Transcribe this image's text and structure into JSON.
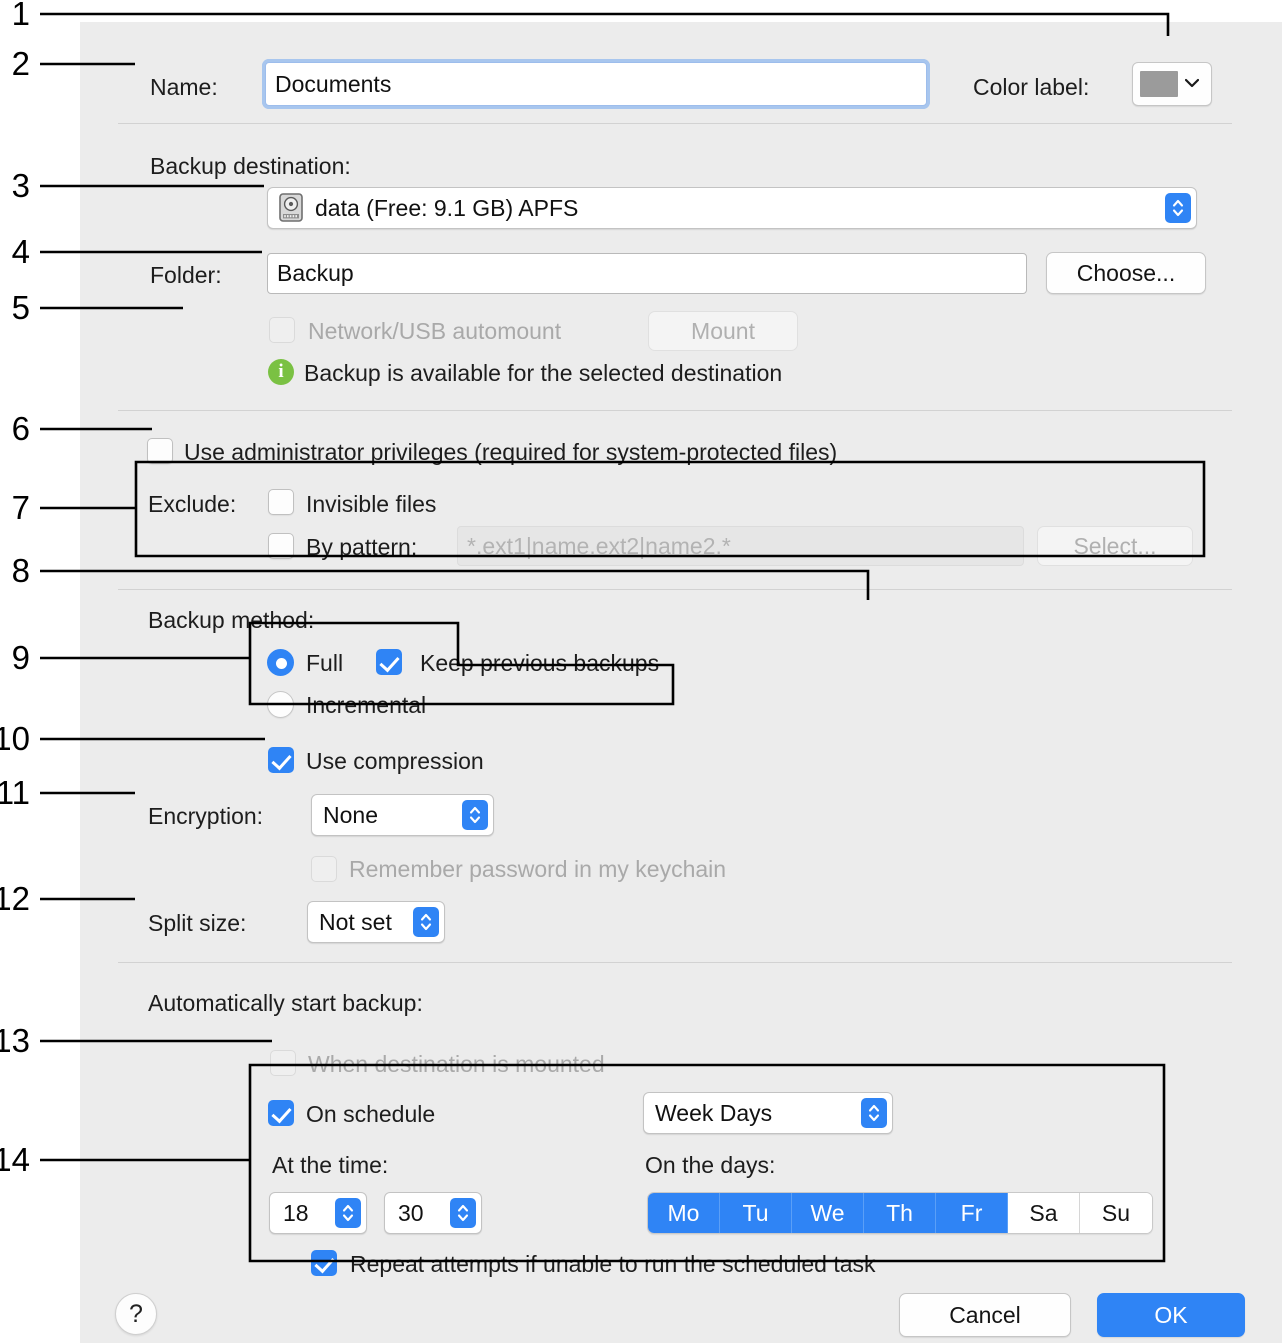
{
  "dialog": {
    "name_row": {
      "label": "Name:",
      "value": "Documents",
      "color_label": "Color label:",
      "swatch_color": "#9b9b9b"
    },
    "destination": {
      "section_label": "Backup destination:",
      "selected": "data (Free: 9.1 GB) APFS",
      "folder_label": "Folder:",
      "folder_value": "Backup",
      "choose_label": "Choose...",
      "automount_label": "Network/USB automount",
      "mount_label": "Mount",
      "status_text": "Backup is available for the selected destination",
      "status_icon": "info-icon",
      "status_color": "#7ac143"
    },
    "privileges": {
      "admin_label": "Use administrator privileges (required for system-protected files)"
    },
    "exclude": {
      "group_label": "Exclude:",
      "invisible_label": "Invisible files",
      "pattern_label": "By pattern:",
      "pattern_placeholder": "*.ext1|name.ext2|name2.*",
      "select_label": "Select..."
    },
    "method": {
      "section_label": "Backup method:",
      "full_label": "Full",
      "incremental_label": "Incremental",
      "keep_previous_label": "Keep previous backups",
      "compression_label": "Use compression"
    },
    "encryption": {
      "label": "Encryption:",
      "value": "None",
      "keychain_label": "Remember password in my keychain"
    },
    "split": {
      "label": "Split size:",
      "value": "Not set"
    },
    "schedule": {
      "section_label": "Automatically start backup:",
      "when_mounted_label": "When destination is mounted",
      "on_schedule_label": "On schedule",
      "frequency_value": "Week Days",
      "time_label": "At the time:",
      "hour_value": "18",
      "minute_value": "30",
      "days_label": "On the days:",
      "days": [
        {
          "label": "Mo",
          "selected": true
        },
        {
          "label": "Tu",
          "selected": true
        },
        {
          "label": "We",
          "selected": true
        },
        {
          "label": "Th",
          "selected": true
        },
        {
          "label": "Fr",
          "selected": true
        },
        {
          "label": "Sa",
          "selected": false
        },
        {
          "label": "Su",
          "selected": false
        }
      ],
      "repeat_label": "Repeat attempts if unable to run the scheduled task"
    },
    "footer": {
      "help_label": "?",
      "cancel_label": "Cancel",
      "ok_label": "OK"
    },
    "accent_color": "#2f84f5",
    "panel_bg": "#ececec"
  },
  "callouts": [
    {
      "n": "1"
    },
    {
      "n": "2"
    },
    {
      "n": "3"
    },
    {
      "n": "4"
    },
    {
      "n": "5"
    },
    {
      "n": "6"
    },
    {
      "n": "7"
    },
    {
      "n": "8"
    },
    {
      "n": "9"
    },
    {
      "n": "10"
    },
    {
      "n": "11"
    },
    {
      "n": "12"
    },
    {
      "n": "13"
    },
    {
      "n": "14"
    }
  ]
}
